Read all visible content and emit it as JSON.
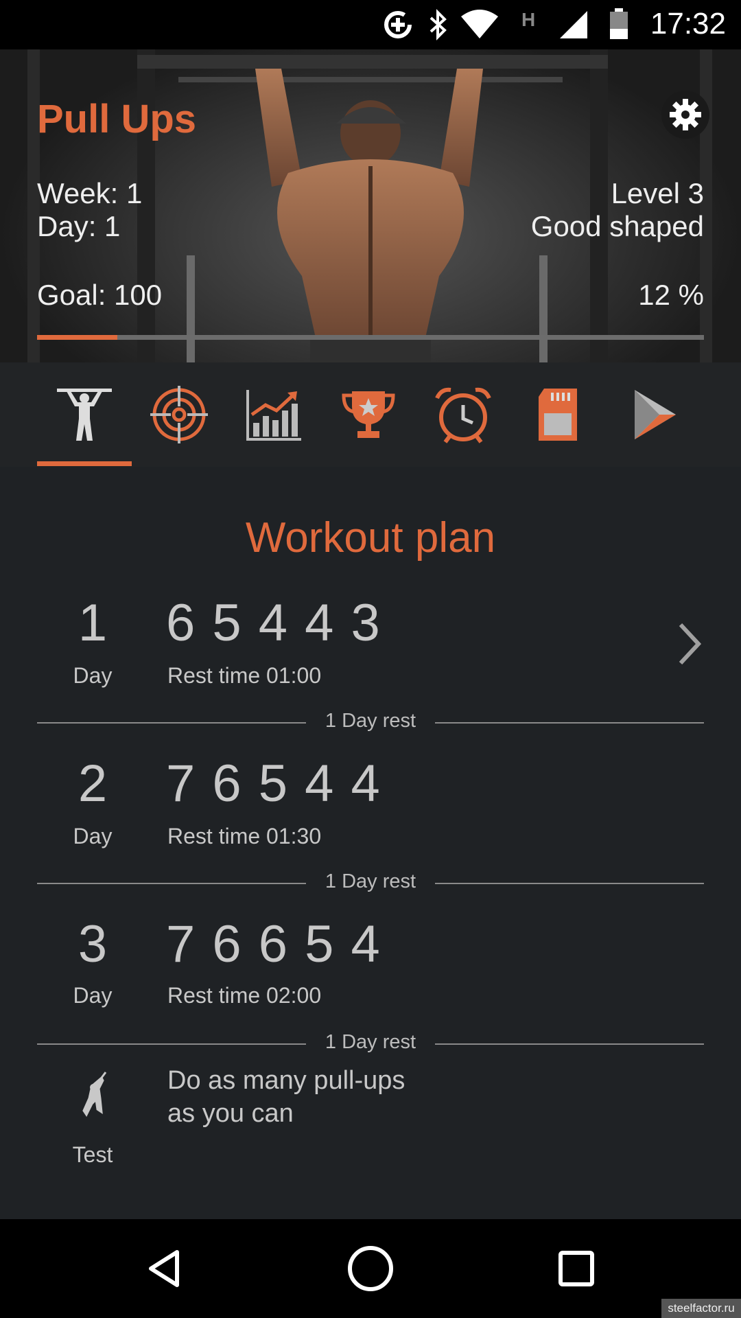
{
  "status_bar": {
    "time": "17:32"
  },
  "header": {
    "title": "Pull Ups",
    "week": "Week: 1",
    "day": "Day: 1",
    "level": "Level 3",
    "level_name": "Good shaped",
    "goal": "Goal: 100",
    "progress_text": "12 %",
    "progress_fraction": 0.12
  },
  "tabs": [
    {
      "icon": "pull-up-figure-icon",
      "selected": true
    },
    {
      "icon": "target-icon",
      "selected": false
    },
    {
      "icon": "chart-icon",
      "selected": false
    },
    {
      "icon": "trophy-icon",
      "selected": false
    },
    {
      "icon": "alarm-clock-icon",
      "selected": false
    },
    {
      "icon": "sd-card-icon",
      "selected": false
    },
    {
      "icon": "play-store-icon",
      "selected": false
    }
  ],
  "workout": {
    "title": "Workout plan",
    "days": [
      {
        "num": "1",
        "label": "Day",
        "reps": "6 5 4 4 3",
        "rest": "Rest time 01:00"
      },
      {
        "num": "2",
        "label": "Day",
        "reps": "7 6 5 4 4",
        "rest": "Rest time 01:30"
      },
      {
        "num": "3",
        "label": "Day",
        "reps": "7 6 6 5 4",
        "rest": "Rest time 02:00"
      }
    ],
    "rest_label": "1 Day rest",
    "test": {
      "label": "Test",
      "line1": "Do as many pull-ups",
      "line2": "as you can"
    }
  },
  "watermark": "steelfactor.ru",
  "colors": {
    "accent": "#e06a3d",
    "background": "#1f2225",
    "text": "#c8c8c8"
  }
}
